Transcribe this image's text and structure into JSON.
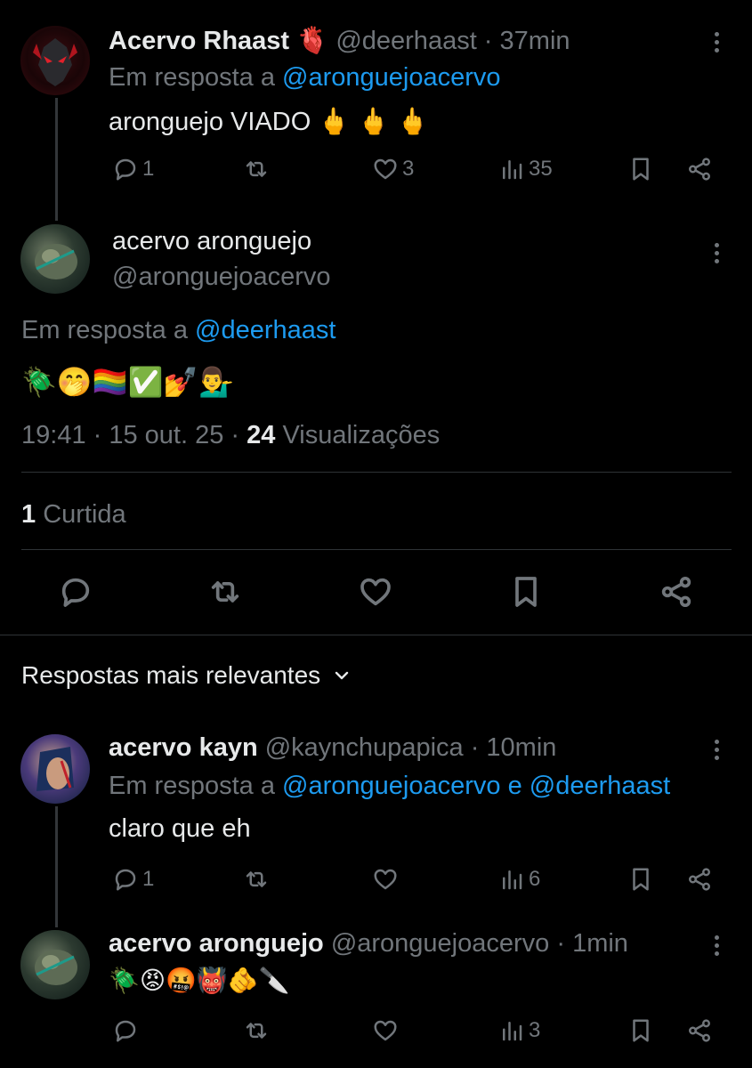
{
  "tweet1": {
    "display_name": "Acervo Rhaast",
    "badge_emoji": "🫀",
    "handle_time": "@deerhaast · 37min",
    "reply_prefix": "Em resposta a",
    "reply_to": "@aronguejoacervo",
    "text": "aronguejo VIADO 🖕 🖕 🖕",
    "replies": "1",
    "likes": "3",
    "views": "35"
  },
  "main": {
    "display_name": "acervo aronguejo",
    "handle": "@aronguejoacervo",
    "reply_prefix": "Em resposta a",
    "reply_to": "@deerhaast",
    "text": "🪲🤭🏳️‍🌈✅💅💁‍♂️",
    "timestamp": "19:41 · 15 out. 25 ·",
    "views_count": "24",
    "views_label": "Visualizações",
    "likes_count": "1",
    "likes_label": "Curtida"
  },
  "sort": {
    "label": "Respostas mais relevantes"
  },
  "reply1": {
    "display_name": "acervo kayn",
    "handle_time": "@kaynchupapica · 10min",
    "reply_prefix": "Em resposta a",
    "reply_to": "@aronguejoacervo e @deerhaast",
    "text": "claro que eh",
    "replies": "1",
    "views": "6"
  },
  "reply2": {
    "display_name": "acervo aronguejo",
    "handle_time": "@aronguejoacervo · 1min",
    "text": "🪲😡🤬👹🫵🔪",
    "views": "3"
  },
  "icons": {
    "reply": "reply-icon",
    "retweet": "retweet-icon",
    "like": "like-icon",
    "views": "views-icon",
    "bookmark": "bookmark-icon",
    "share": "share-icon",
    "more": "more-icon"
  },
  "colors": {
    "background": "#000000",
    "text": "#e7e9ea",
    "muted": "#71767b",
    "link": "#1d9bf0",
    "divider": "#2f3336"
  }
}
